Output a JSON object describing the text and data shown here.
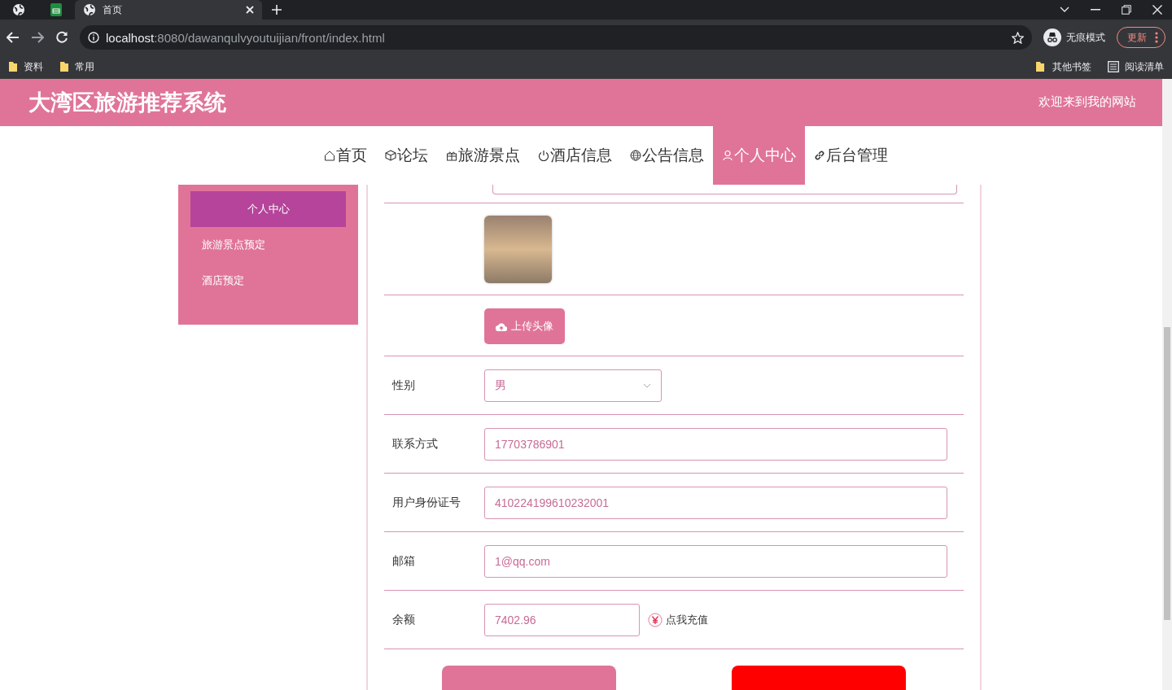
{
  "browser": {
    "tabs": [
      {
        "title": "首页",
        "selected": true
      }
    ],
    "url": {
      "host": "localhost",
      "path": ":8080/dawanqulvyoutuijian/front/index.html"
    },
    "profile": "无痕模式",
    "update_button": "更新",
    "bookmarks": [
      "资料",
      "常用"
    ],
    "bookmarks_right": [
      {
        "kind": "folder",
        "label": "其他书签"
      },
      {
        "kind": "list",
        "label": "阅读清单"
      }
    ]
  },
  "header": {
    "title": "大湾区旅游推荐系统",
    "welcome": "欢迎来到我的网站"
  },
  "nav": {
    "items": [
      {
        "kind": "home",
        "label": "首页",
        "selected": false
      },
      {
        "kind": "cube",
        "label": "论坛",
        "selected": false
      },
      {
        "kind": "gift",
        "label": "旅游景点",
        "selected": false
      },
      {
        "kind": "power",
        "label": "酒店信息",
        "selected": false
      },
      {
        "kind": "globe",
        "label": "公告信息",
        "selected": false
      },
      {
        "kind": "user",
        "label": "个人中心",
        "selected": true
      },
      {
        "kind": "link",
        "label": "后台管理",
        "selected": false
      }
    ]
  },
  "sidebar": {
    "items": [
      {
        "label": "个人中心",
        "selected": true
      },
      {
        "label": "旅游景点预定",
        "selected": false
      },
      {
        "label": "酒店预定",
        "selected": false
      }
    ]
  },
  "form": {
    "upload_button": "上传头像",
    "fields": [
      {
        "kind": "select",
        "label": "性别",
        "value": "男"
      },
      {
        "kind": "text",
        "label": "联系方式",
        "value": "17703786901"
      },
      {
        "kind": "text",
        "label": "用户身份证号",
        "value": "410224199610232001"
      },
      {
        "kind": "text",
        "label": "邮箱",
        "value": "1@qq.com"
      },
      {
        "kind": "balance",
        "label": "余额",
        "value": "7402.96",
        "action": "点我充值"
      }
    ],
    "buttons": [
      {
        "color": "#e07498"
      },
      {
        "color": "#ff0000"
      }
    ]
  }
}
